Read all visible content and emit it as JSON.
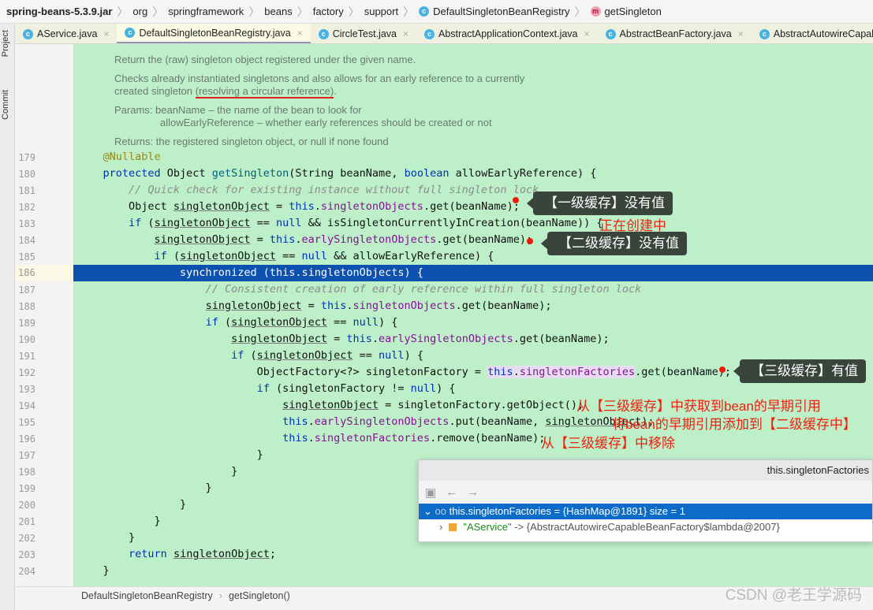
{
  "breadcrumb": [
    {
      "label": "spring-beans-5.3.9.jar",
      "icon": ""
    },
    {
      "label": "org",
      "icon": ""
    },
    {
      "label": "springframework",
      "icon": ""
    },
    {
      "label": "beans",
      "icon": ""
    },
    {
      "label": "factory",
      "icon": ""
    },
    {
      "label": "support",
      "icon": ""
    },
    {
      "label": "DefaultSingletonBeanRegistry",
      "icon": "class-icon"
    },
    {
      "label": "getSingleton",
      "icon": "method-icon"
    }
  ],
  "side_tabs": {
    "project": "Project",
    "commit": "Commit"
  },
  "tabs": [
    {
      "label": "AService.java",
      "active": false
    },
    {
      "label": "DefaultSingletonBeanRegistry.java",
      "active": true
    },
    {
      "label": "CircleTest.java",
      "active": false
    },
    {
      "label": "AbstractApplicationContext.java",
      "active": false
    },
    {
      "label": "AbstractBeanFactory.java",
      "active": false
    },
    {
      "label": "AbstractAutowireCapableBeanFactory.java",
      "active": false
    }
  ],
  "javadoc": {
    "l1": "Return the (raw) singleton object registered under the given name.",
    "l2": "Checks already instantiated singletons and also allows for an early reference to a currently",
    "l3a": "created singleton ",
    "l3b": "(resolving a circular reference)",
    "l3c": ".",
    "l4": "Params:  beanName – the name of the bean to look for",
    "l5": "allowEarlyReference – whether early references should be created or not",
    "l6": "Returns: the registered singleton object, or null if none found"
  },
  "code": [
    {
      "n": "179",
      "t": [
        [
          "    "
        ],
        [
          "@Nullable",
          "ann"
        ]
      ]
    },
    {
      "n": "180",
      "t": [
        [
          "    "
        ],
        [
          "protected",
          "kw"
        ],
        [
          " Object "
        ],
        [
          "getSingleton",
          "mth"
        ],
        [
          "(String beanName, "
        ],
        [
          "boolean",
          "kw"
        ],
        [
          " allowEarlyReference) {"
        ]
      ]
    },
    {
      "n": "181",
      "t": [
        [
          "        "
        ],
        [
          "// Quick check for existing instance without full singleton lock",
          "cm"
        ]
      ]
    },
    {
      "n": "182",
      "t": [
        [
          "        Object "
        ],
        [
          "singletonObject",
          "u"
        ],
        [
          " = "
        ],
        [
          "this",
          "kw"
        ],
        [
          "."
        ],
        [
          "singletonObjects",
          "fld"
        ],
        [
          ".get(beanName);"
        ]
      ]
    },
    {
      "n": "183",
      "t": [
        [
          "        "
        ],
        [
          "if",
          "kw"
        ],
        [
          " ("
        ],
        [
          "singletonObject",
          "u"
        ],
        [
          " == "
        ],
        [
          "null",
          "kw"
        ],
        [
          " && isSingletonCurrentlyInCreation(beanName)) {"
        ]
      ]
    },
    {
      "n": "184",
      "t": [
        [
          "            "
        ],
        [
          "singletonObject",
          "u"
        ],
        [
          " = "
        ],
        [
          "this",
          "kw"
        ],
        [
          "."
        ],
        [
          "earlySingletonObjects",
          "fld"
        ],
        [
          ".get(beanName);"
        ]
      ]
    },
    {
      "n": "185",
      "t": [
        [
          "            "
        ],
        [
          "if",
          "kw"
        ],
        [
          " ("
        ],
        [
          "singletonObject",
          "u"
        ],
        [
          " == "
        ],
        [
          "null",
          "kw"
        ],
        [
          " && allowEarlyReference) {"
        ]
      ]
    },
    {
      "n": "186",
      "t": [
        [
          "                synchronized (this.singletonObjects) {"
        ]
      ],
      "hl": true
    },
    {
      "n": "187",
      "t": [
        [
          "                    "
        ],
        [
          "// Consistent creation of early reference within full singleton lock",
          "cm"
        ]
      ]
    },
    {
      "n": "188",
      "t": [
        [
          "                    "
        ],
        [
          "singletonObject",
          "u"
        ],
        [
          " = "
        ],
        [
          "this",
          "kw"
        ],
        [
          "."
        ],
        [
          "singletonObjects",
          "fld"
        ],
        [
          ".get(beanName);"
        ]
      ]
    },
    {
      "n": "189",
      "t": [
        [
          "                    "
        ],
        [
          "if",
          "kw"
        ],
        [
          " ("
        ],
        [
          "singletonObject",
          "u"
        ],
        [
          " == "
        ],
        [
          "null",
          "kw"
        ],
        [
          ") {"
        ]
      ]
    },
    {
      "n": "190",
      "t": [
        [
          "                        "
        ],
        [
          "singletonObject",
          "u"
        ],
        [
          " = "
        ],
        [
          "this",
          "kw"
        ],
        [
          "."
        ],
        [
          "earlySingletonObjects",
          "fld"
        ],
        [
          ".get(beanName);"
        ]
      ]
    },
    {
      "n": "191",
      "t": [
        [
          "                        "
        ],
        [
          "if",
          "kw"
        ],
        [
          " ("
        ],
        [
          "singletonObject",
          "u"
        ],
        [
          " == "
        ],
        [
          "null",
          "kw"
        ],
        [
          ") {"
        ]
      ]
    },
    {
      "n": "192",
      "t": [
        [
          "                            ObjectFactory<?> singletonFactory = "
        ],
        [
          "this",
          "kw hb"
        ],
        [
          ".",
          "hb"
        ],
        [
          "singletonFactories",
          "fld hb"
        ],
        [
          ".get(beanName);"
        ]
      ]
    },
    {
      "n": "193",
      "t": [
        [
          "                            "
        ],
        [
          "if",
          "kw"
        ],
        [
          " (singletonFactory != "
        ],
        [
          "null",
          "kw"
        ],
        [
          ") {"
        ]
      ]
    },
    {
      "n": "194",
      "t": [
        [
          "                                "
        ],
        [
          "singletonObject",
          "u"
        ],
        [
          " = singletonFactory.getObject();"
        ]
      ]
    },
    {
      "n": "195",
      "t": [
        [
          "                                "
        ],
        [
          "this",
          "kw"
        ],
        [
          "."
        ],
        [
          "earlySingletonObjects",
          "fld"
        ],
        [
          ".put(beanName, "
        ],
        [
          "singletonObject",
          "u"
        ],
        [
          ");"
        ]
      ]
    },
    {
      "n": "196",
      "t": [
        [
          "                                "
        ],
        [
          "this",
          "kw"
        ],
        [
          "."
        ],
        [
          "singletonFactories",
          "fld"
        ],
        [
          ".remove(beanName);"
        ]
      ]
    },
    {
      "n": "197",
      "t": [
        [
          "                            }"
        ]
      ]
    },
    {
      "n": "198",
      "t": [
        [
          "                        }"
        ]
      ]
    },
    {
      "n": "199",
      "t": [
        [
          "                    }"
        ]
      ]
    },
    {
      "n": "200",
      "t": [
        [
          "                }"
        ]
      ]
    },
    {
      "n": "201",
      "t": [
        [
          "            }"
        ]
      ]
    },
    {
      "n": "202",
      "t": [
        [
          "        }"
        ]
      ]
    },
    {
      "n": "203",
      "t": [
        [
          "        "
        ],
        [
          "return",
          "kw"
        ],
        [
          " "
        ],
        [
          "singletonObject",
          "u"
        ],
        [
          ";"
        ]
      ]
    },
    {
      "n": "204",
      "t": [
        [
          "    }"
        ]
      ]
    }
  ],
  "annotations": {
    "c1": "【一级缓存】没有值",
    "creating": "正在创建中",
    "c2": "【二级缓存】没有值",
    "c3": "【三级缓存】有值",
    "r194": "从【三级缓存】中获取到bean的早期引用",
    "r195": "将bean的早期引用添加到【二级缓存中】",
    "r196": "从【三级缓存】中移除"
  },
  "debug_popup": {
    "title": "this.singletonFactories",
    "row1": "this.singletonFactories = {HashMap@1891}  size = 1",
    "row2_key": "\"AService\"",
    "row2_val": " -> {AbstractAutowireCapableBeanFactory$lambda@2007}"
  },
  "bottom_breadcrumb": {
    "cls": "DefaultSingletonBeanRegistry",
    "method": "getSingleton()"
  },
  "watermark": "CSDN @老王学源码",
  "colors": {
    "editor_bg": "#bdefc9",
    "highlight": "#0d51b0",
    "annotation_red": "#f0200e"
  }
}
